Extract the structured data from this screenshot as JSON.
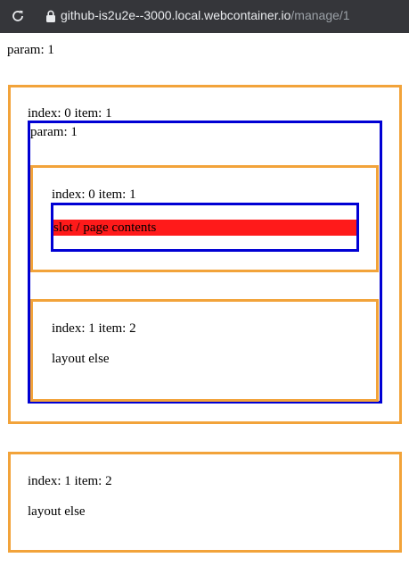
{
  "browser": {
    "url_host": "github-is2u2e--3000.local.webcontainer.io",
    "url_path": "/manage/1"
  },
  "page": {
    "top_param": "param: 1",
    "outer_layout_0": {
      "index_item": "index: 0 item: 1",
      "inner_param": "param: 1",
      "nested_layout_0": {
        "index_item": "index: 0 item: 1",
        "slot_text": "slot / page contents"
      },
      "nested_layout_1": {
        "index_item": "index: 1 item: 2",
        "else_text": "layout else"
      }
    },
    "outer_layout_1": {
      "index_item": "index: 1 item: 2",
      "else_text": "layout else"
    }
  },
  "colors": {
    "browser_bar": "#35363a",
    "layout_border": "#f2a33a",
    "page_border": "#0000d4",
    "slot_background": "#ff1a1a"
  },
  "icons": [
    "reload-icon",
    "lock-icon"
  ]
}
